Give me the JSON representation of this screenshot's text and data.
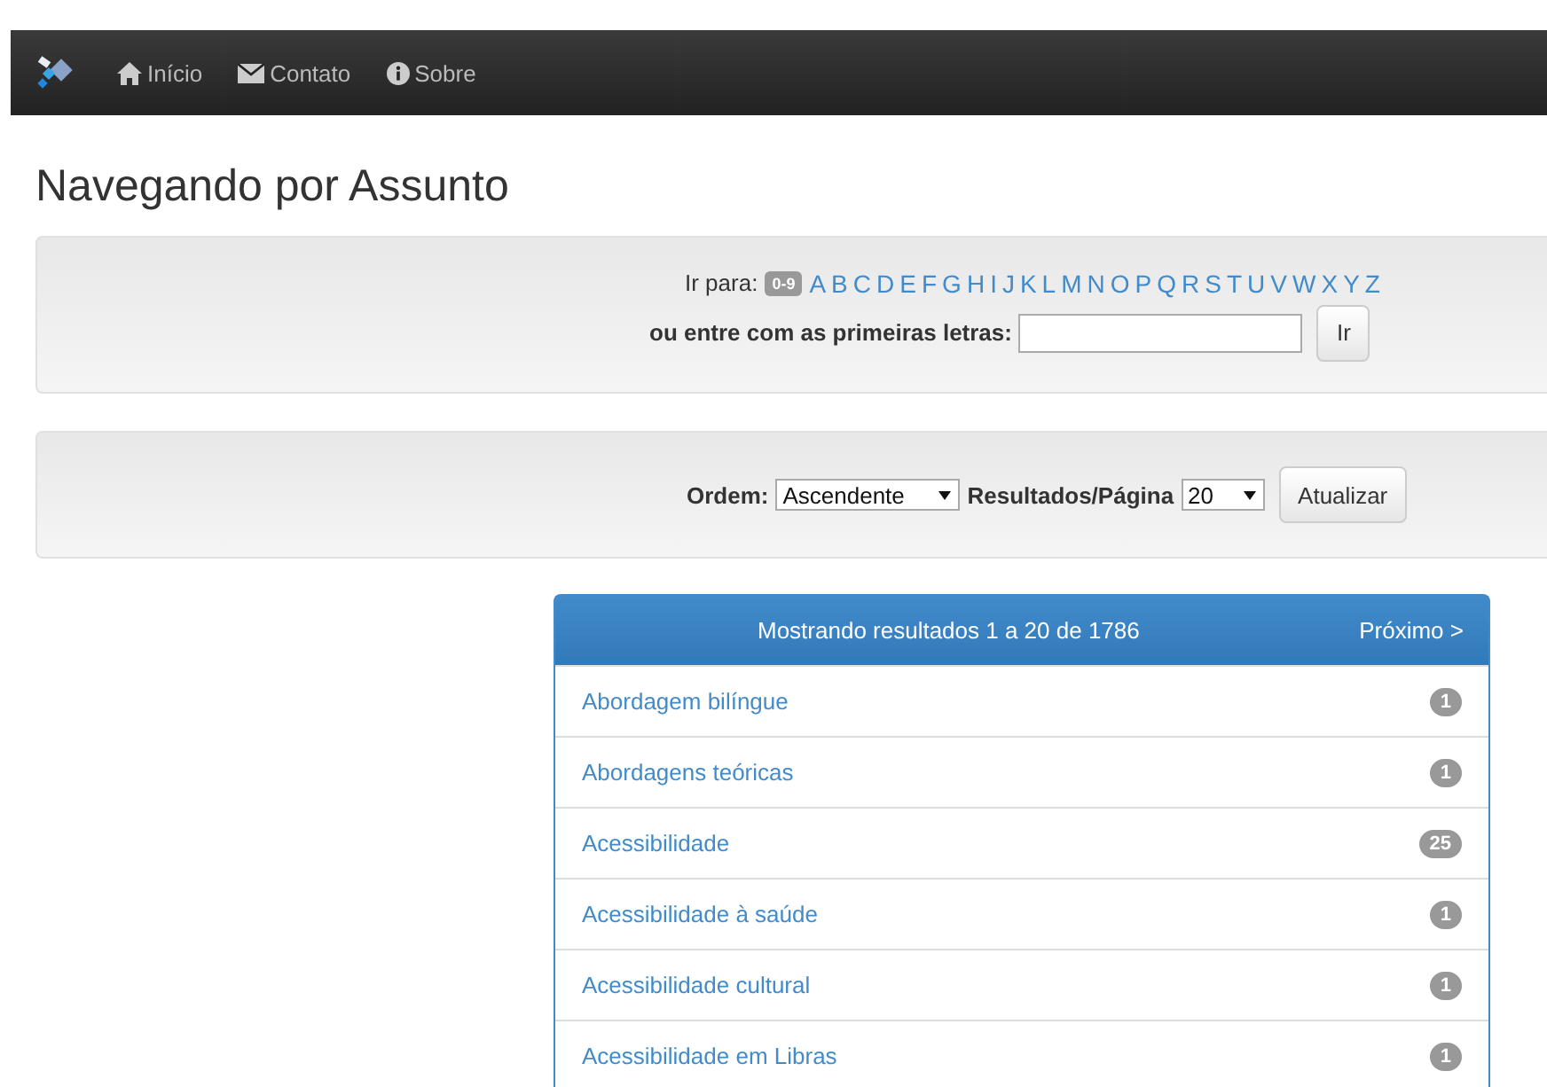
{
  "navbar": {
    "items": [
      {
        "kind": "home",
        "label": "Início"
      },
      {
        "kind": "mail",
        "label": "Contato"
      },
      {
        "kind": "info",
        "label": "Sobre"
      }
    ]
  },
  "title": "Navegando por Assunto",
  "jump": {
    "label": "Ir para:",
    "range": "0-9",
    "letters": [
      "A",
      "B",
      "C",
      "D",
      "E",
      "F",
      "G",
      "H",
      "I",
      "J",
      "K",
      "L",
      "M",
      "N",
      "O",
      "P",
      "Q",
      "R",
      "S",
      "T",
      "U",
      "V",
      "W",
      "X",
      "Y",
      "Z"
    ],
    "prompt": "ou entre com as primeiras letras:",
    "button": "Ir"
  },
  "controls": {
    "order_label": "Ordem:",
    "order_value": "Ascendente",
    "per_page_label": "Resultados/Página",
    "per_page_value": "20",
    "button": "Atualizar"
  },
  "results": {
    "summary": "Mostrando resultados 1 a 20 de 1786",
    "next": "Próximo >",
    "rows": [
      {
        "label": "Abordagem bilíngue",
        "count": "1"
      },
      {
        "label": "Abordagens teóricas",
        "count": "1"
      },
      {
        "label": "Acessibilidade",
        "count": "25"
      },
      {
        "label": "Acessibilidade à saúde",
        "count": "1"
      },
      {
        "label": "Acessibilidade cultural",
        "count": "1"
      },
      {
        "label": "Acessibilidade em Libras",
        "count": "1"
      }
    ]
  }
}
